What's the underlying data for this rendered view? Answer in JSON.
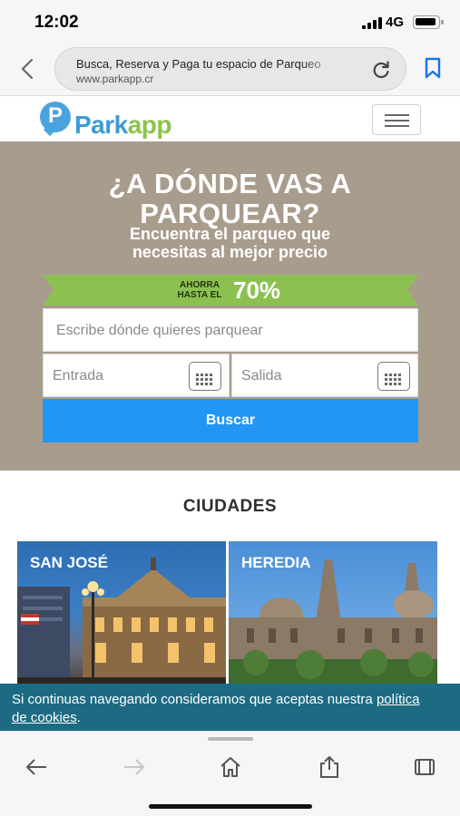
{
  "status_bar": {
    "time": "12:02",
    "network": "4G"
  },
  "browser": {
    "page_title": "Busca, Reserva y Paga tu espacio de Parqueo",
    "url": "www.parkapp.cr",
    "icons": [
      "back-icon",
      "reload-icon",
      "bookmark-icon"
    ]
  },
  "header": {
    "logo_mark": "P",
    "logo_park": "Park",
    "logo_app": "app",
    "menu_icon": "hamburger-icon"
  },
  "hero": {
    "title": "¿A DÓNDE VAS A PARQUEAR?",
    "subtitle": "Encuentra el parqueo que necesitas al mejor precio",
    "promo_small": "AHORRA HASTA EL",
    "promo_big": "70%",
    "search_placeholder": "Escribe dónde quieres parquear",
    "entry_placeholder": "Entrada",
    "exit_placeholder": "Salida",
    "search_button": "Buscar"
  },
  "cities": {
    "title": "CIUDADES",
    "items": [
      {
        "name": "SAN JOSÉ"
      },
      {
        "name": "HEREDIA"
      }
    ]
  },
  "cookie": {
    "text_before": "Si continuas navegando consideramos que aceptas nuestra ",
    "link": "política de cookies",
    "text_after": "."
  },
  "toolbar": {
    "icons": [
      "back-arrow-icon",
      "forward-arrow-icon",
      "home-icon",
      "share-icon",
      "tabs-icon"
    ]
  },
  "colors": {
    "hero_bg": "#a89c8d",
    "promo_green": "#8cc152",
    "button_blue": "#2196f3",
    "cookie_bg": "#1d6b83",
    "brand_blue": "#3d9bd5",
    "brand_green": "#8bc34a"
  }
}
